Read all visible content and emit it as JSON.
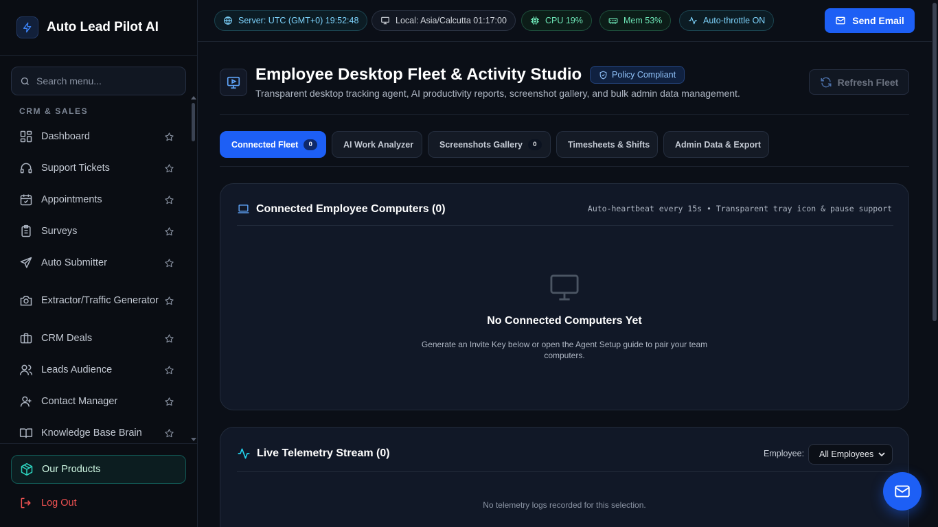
{
  "app": {
    "name": "Auto Lead Pilot AI"
  },
  "sidebar": {
    "search_placeholder": "Search menu...",
    "section_title": "CRM & SALES",
    "items": [
      {
        "label": "Dashboard",
        "icon": "dashboard-grid-icon"
      },
      {
        "label": "Support Tickets",
        "icon": "headset-icon"
      },
      {
        "label": "Appointments",
        "icon": "calendar-icon"
      },
      {
        "label": "Surveys",
        "icon": "clipboard-icon"
      },
      {
        "label": "Auto Submitter",
        "icon": "send-icon"
      },
      {
        "label": "Extractor/Traffic Generator",
        "icon": "camera-icon"
      },
      {
        "label": "CRM Deals",
        "icon": "briefcase-icon"
      },
      {
        "label": "Leads Audience",
        "icon": "users-icon"
      },
      {
        "label": "Contact Manager",
        "icon": "user-group-icon"
      },
      {
        "label": "Knowledge Base Brain",
        "icon": "book-icon"
      }
    ],
    "footer": {
      "products_label": "Our Products",
      "logout_label": "Log Out"
    }
  },
  "topbar": {
    "server_time": "Server: UTC (GMT+0) 19:52:48",
    "local_time": "Local: Asia/Calcutta 01:17:00",
    "cpu": "CPU 19%",
    "mem": "Mem 53%",
    "throttle": "Auto-throttle ON",
    "send_email_label": "Send Email"
  },
  "page": {
    "title": "Employee Desktop Fleet & Activity Studio",
    "badge": "Policy Compliant",
    "subtitle": "Transparent desktop tracking agent, AI productivity reports, screenshot gallery, and bulk admin data management.",
    "refresh_label": "Refresh Fleet"
  },
  "tabs": [
    {
      "label": "Connected Fleet",
      "count": "0",
      "active": true
    },
    {
      "label": "AI Work Analyzer"
    },
    {
      "label": "Screenshots Gallery",
      "count": "0"
    },
    {
      "label": "Timesheets & Shifts"
    },
    {
      "label": "Admin Data & Export"
    }
  ],
  "fleet_card": {
    "title": "Connected Employee Computers (0)",
    "note": "Auto-heartbeat every 15s • Transparent tray icon & pause support",
    "empty_title": "No Connected Computers Yet",
    "empty_desc": "Generate an Invite Key below or open the Agent Setup guide to pair your team computers."
  },
  "telemetry_card": {
    "title": "Live Telemetry Stream (0)",
    "employee_label": "Employee:",
    "employee_selected": "All Employees",
    "no_logs": "No telemetry logs recorded for this selection."
  },
  "colors": {
    "accent": "#1d5ff5",
    "background": "#0b0f17",
    "card": "#111827",
    "teal": "#7dd3fc",
    "green": "#6ee7b7",
    "danger": "#f05252"
  }
}
